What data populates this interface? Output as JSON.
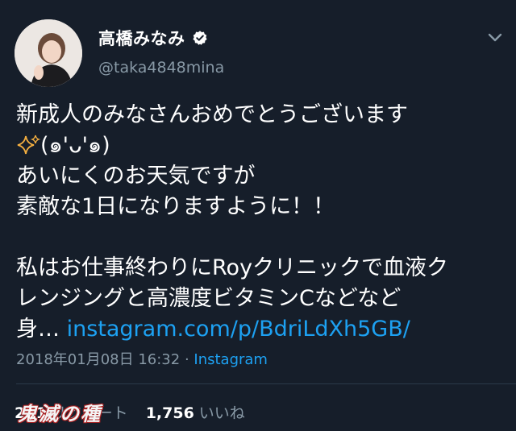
{
  "user": {
    "display_name": "高橋みなみ",
    "handle": "@taka4848mina",
    "verified": true,
    "verified_color": "#ffffff"
  },
  "tweet": {
    "line1": "新成人のみなさんおめでとうございます",
    "line2_kaomoji": "(๑'ᴗ'๑)",
    "line3": "あいにくのお天気ですが",
    "line4": "素敵な1日になりますように！！",
    "line5": "私はお仕事終わりにRoyクリニックで血液ク",
    "line6": "レンジングと高濃度ビタミンCなどなど",
    "line7_prefix": "身… ",
    "link_text": "instagram.com/p/BdriLdXh5GB/",
    "link_color": "#1da1f2"
  },
  "meta": {
    "timestamp": "2018年01月08日 16:32",
    "separator": " · ",
    "source": "Instagram"
  },
  "stats": {
    "retweets_count": "211",
    "retweets_label": "リツイート",
    "likes_count": "1,756",
    "likes_label": "いいね"
  },
  "watermark": {
    "text": "鬼滅の種"
  },
  "icons": {
    "sparkle": "sparkles-icon",
    "chevron": "chevron-down-icon",
    "verified": "verified-badge-icon"
  },
  "colors": {
    "background": "#161e2a",
    "secondary_text": "#8899a6",
    "accent": "#1da1f2",
    "sparkle": "#f5b041"
  }
}
